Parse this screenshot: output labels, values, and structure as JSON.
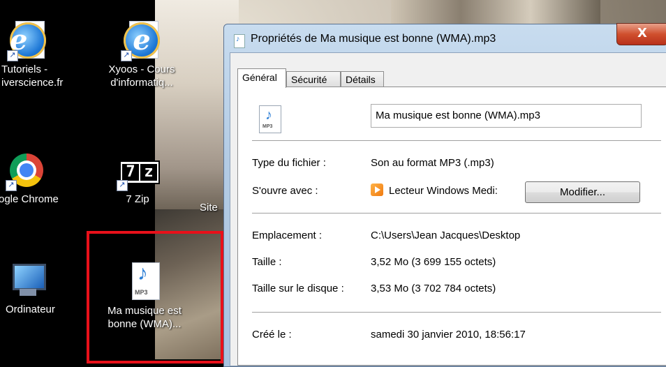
{
  "desktop": {
    "icons": [
      {
        "label": "Tutoriels -",
        "label2": "iverscience.fr"
      },
      {
        "label": "Xyoos - Cours",
        "label2": "d'informatiq..."
      },
      {
        "label": "ogle Chrome"
      },
      {
        "label": "7 Zip"
      },
      {
        "label": "Ordinateur"
      },
      {
        "label": "Ma musique est",
        "label2": "bonne (WMA)..."
      }
    ],
    "partial_site_label": "Site",
    "sevenzip_glyph": "7z",
    "mp3_badge": "MP3",
    "selection_color": "#e8101a"
  },
  "window": {
    "title": "Propriétés de Ma musique est bonne (WMA).mp3",
    "close_label": "X",
    "tabs": [
      {
        "label": "Général",
        "active": true
      },
      {
        "label": "Sécurité",
        "active": false
      },
      {
        "label": "Détails",
        "active": false
      }
    ],
    "file_name": "Ma musique est bonne (WMA).mp3",
    "props": {
      "type_label": "Type du fichier :",
      "type_value": "Son au format MP3 (.mp3)",
      "opens_label": "S'ouvre avec :",
      "opens_value": "Lecteur Windows Medi:",
      "modify_label": "Modifier...",
      "location_label": "Emplacement :",
      "location_value": "C:\\Users\\Jean Jacques\\Desktop",
      "size_label": "Taille :",
      "size_value": "3,52 Mo (3 699 155 octets)",
      "disk_size_label": "Taille sur le disque :",
      "disk_size_value": "3,53 Mo (3 702 784 octets)",
      "created_label": "Créé le :",
      "created_value": "samedi 30 janvier 2010, 18:56:17"
    }
  }
}
